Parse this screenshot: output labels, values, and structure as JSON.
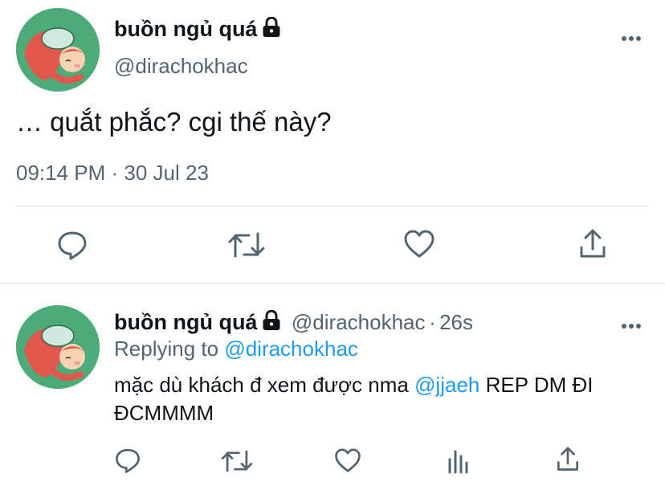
{
  "main_tweet": {
    "display_name": "buồn ngủ quá",
    "handle": "@dirachokhac",
    "text": "… quắt phắc? cgi thế này?",
    "timestamp": "09:14 PM · 30 Jul 23",
    "actions": [
      "reply-icon",
      "retweet-icon",
      "like-icon",
      "share-icon"
    ]
  },
  "reply_tweet": {
    "display_name": "buồn ngủ quá",
    "handle": "@dirachokhac",
    "separator": "·",
    "time_ago": "26s",
    "replying_prefix": "Replying to",
    "replying_handle": "@dirachokhac",
    "text_before": "mặc dù khách đ xem được nma ",
    "mention": "@jjaeh",
    "text_after": " REP DM ĐI ĐCMMMM",
    "actions": [
      "reply-icon",
      "retweet-icon",
      "like-icon",
      "analytics-icon",
      "share-icon"
    ]
  },
  "colors": {
    "avatar_bg": "#4dab79",
    "link": "#1d9bf0",
    "secondary_text": "#536471"
  }
}
